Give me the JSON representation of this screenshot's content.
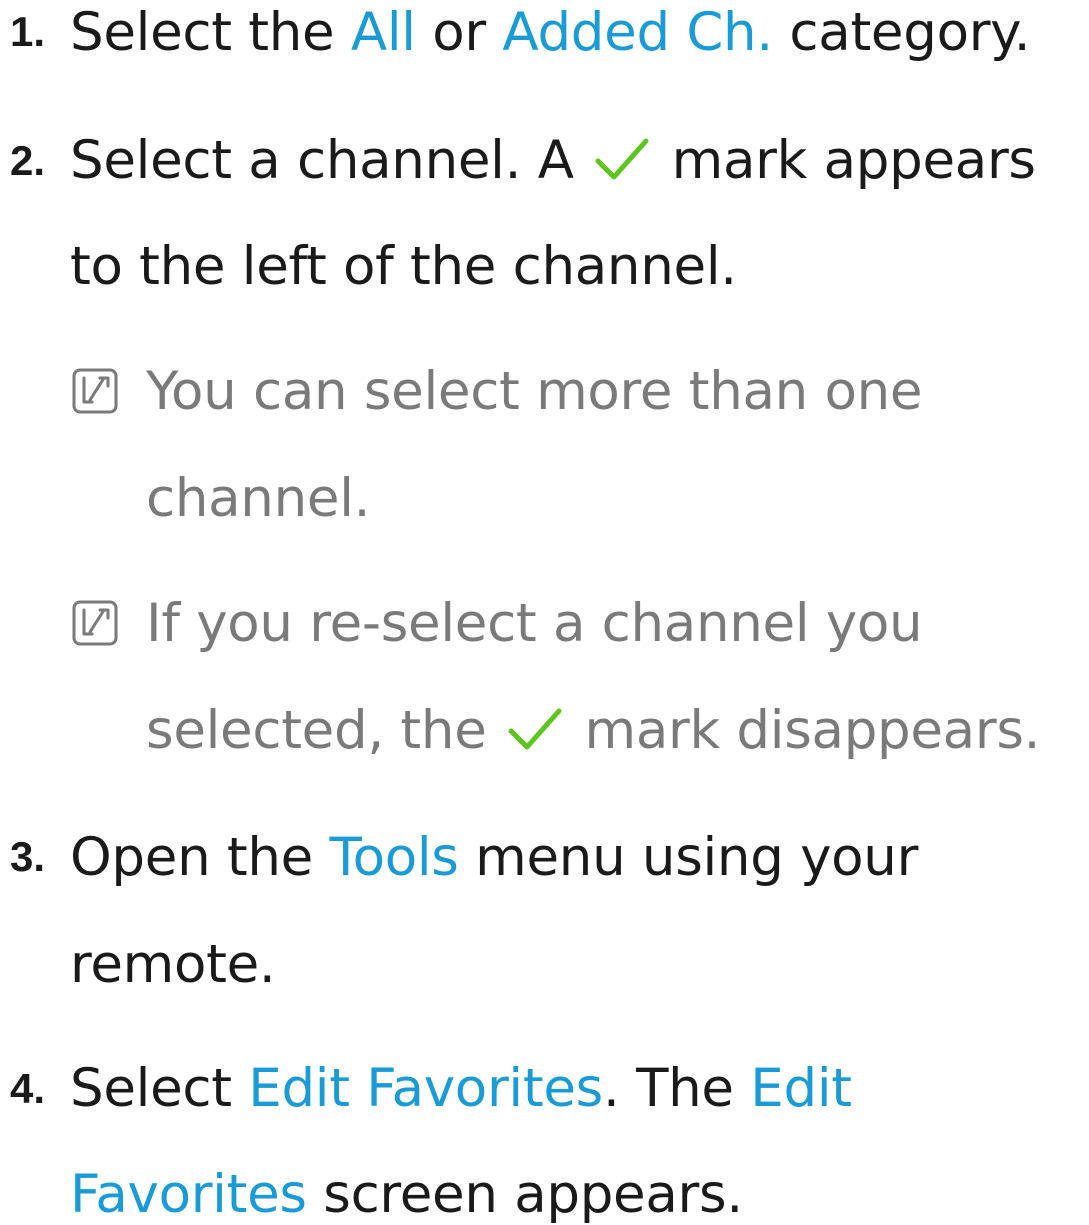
{
  "steps": [
    {
      "number": "1.",
      "lines": [
        {
          "parts": [
            {
              "text": "Select the ",
              "style": "plain"
            },
            {
              "text": "All",
              "style": "highlight"
            },
            {
              "text": " or ",
              "style": "plain"
            },
            {
              "text": "Added Ch.",
              "style": "highlight"
            },
            {
              "text": " category.",
              "style": "plain"
            }
          ]
        }
      ]
    },
    {
      "number": "2.",
      "lines": [
        {
          "parts": [
            {
              "text": "Select a channel. A",
              "style": "plain"
            },
            {
              "icon": "checkmark-icon"
            },
            {
              "text": "mark appears",
              "style": "plain"
            }
          ]
        },
        {
          "parts": [
            {
              "text": "to the left of the channel.",
              "style": "plain"
            }
          ]
        }
      ],
      "notes": [
        {
          "icon": "note-icon",
          "lines": [
            {
              "parts": [
                {
                  "text": "You can select more than one"
                }
              ]
            },
            {
              "parts": [
                {
                  "text": "channel."
                }
              ]
            }
          ]
        },
        {
          "icon": "note-icon",
          "lines": [
            {
              "parts": [
                {
                  "text": "If you re-select a channel you"
                }
              ]
            },
            {
              "parts": [
                {
                  "text": "selected, the"
                },
                {
                  "icon": "checkmark-icon"
                },
                {
                  "text": "mark disappears."
                }
              ]
            }
          ]
        }
      ]
    },
    {
      "number": "3.",
      "lines": [
        {
          "parts": [
            {
              "text": "Open the ",
              "style": "plain"
            },
            {
              "text": "Tools",
              "style": "highlight"
            },
            {
              "text": " menu using your",
              "style": "plain"
            }
          ]
        },
        {
          "parts": [
            {
              "text": "remote.",
              "style": "plain"
            }
          ]
        }
      ]
    },
    {
      "number": "4.",
      "lines": [
        {
          "parts": [
            {
              "text": "Select ",
              "style": "plain"
            },
            {
              "text": "Edit Favorites",
              "style": "highlight"
            },
            {
              "text": ". The ",
              "style": "plain"
            },
            {
              "text": "Edit",
              "style": "highlight"
            }
          ]
        },
        {
          "parts": [
            {
              "text": "Favorites",
              "style": "highlight"
            },
            {
              "text": " screen appears.",
              "style": "plain"
            }
          ]
        }
      ]
    }
  ],
  "colors": {
    "text": "#1a1a1a",
    "highlight": "#1a9ad6",
    "note": "#7a7a7a",
    "check": "#5cc61e"
  }
}
